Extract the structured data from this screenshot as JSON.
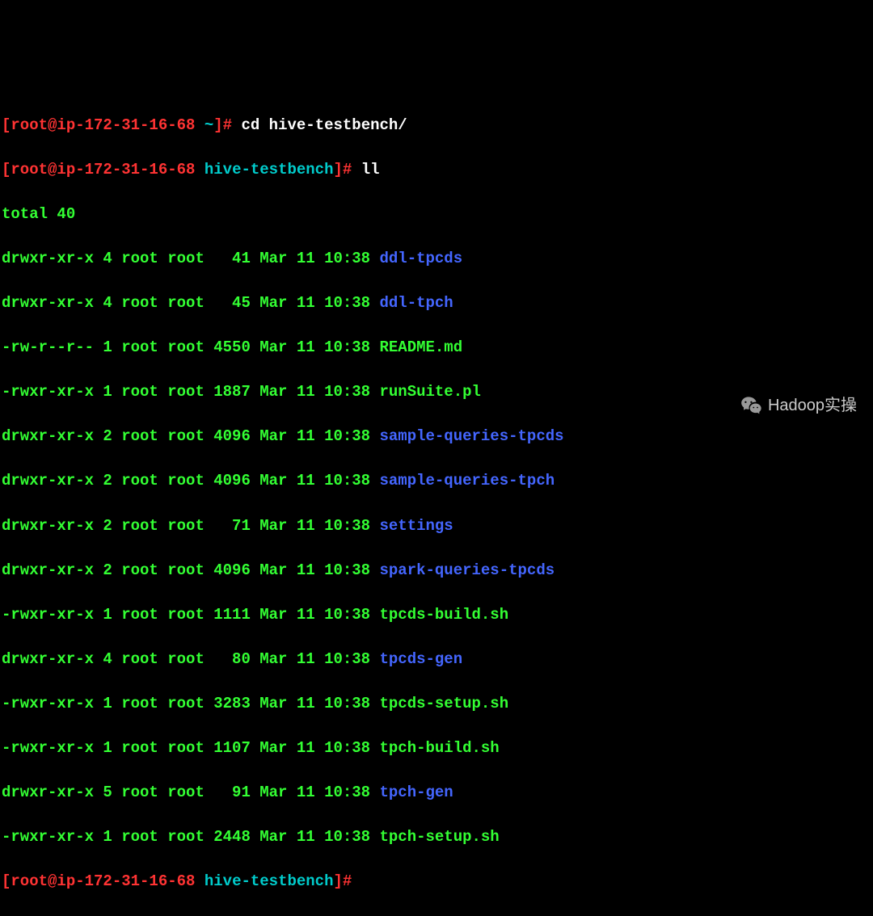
{
  "prompt1": {
    "bracket_open": "[",
    "user_host": "root@ip-172-31-16-68",
    "space": " ",
    "cwd": "~",
    "bracket_close": "]#",
    "command": " cd hive-testbench/"
  },
  "prompt2": {
    "bracket_open": "[",
    "user_host": "root@ip-172-31-16-68",
    "space": " ",
    "cwd": "hive-testbench",
    "bracket_close": "]#",
    "command": " ll"
  },
  "total": "total 40",
  "listing": {
    "l1": {
      "meta": "drwxr-xr-x 4 root root   41 Mar 11 10:38 ",
      "name": "ddl-tpcds"
    },
    "l2": {
      "meta": "drwxr-xr-x 4 root root   45 Mar 11 10:38 ",
      "name": "ddl-tpch"
    },
    "l3": {
      "meta": "-rw-r--r-- 1 root root 4550 Mar 11 10:38 ",
      "name": "README.md"
    },
    "l4": {
      "meta": "-rwxr-xr-x 1 root root 1887 Mar 11 10:38 ",
      "name": "runSuite.pl"
    },
    "l5": {
      "meta": "drwxr-xr-x 2 root root 4096 Mar 11 10:38 ",
      "name": "sample-queries-tpcds"
    },
    "l6": {
      "meta": "drwxr-xr-x 2 root root 4096 Mar 11 10:38 ",
      "name": "sample-queries-tpch"
    },
    "l7": {
      "meta": "drwxr-xr-x 2 root root   71 Mar 11 10:38 ",
      "name": "settings"
    },
    "l8": {
      "meta": "drwxr-xr-x 2 root root 4096 Mar 11 10:38 ",
      "name": "spark-queries-tpcds"
    },
    "l9": {
      "meta": "-rwxr-xr-x 1 root root 1111 Mar 11 10:38 ",
      "name": "tpcds-build.sh"
    },
    "l10": {
      "meta": "drwxr-xr-x 4 root root   80 Mar 11 10:38 ",
      "name": "tpcds-gen"
    },
    "l11": {
      "meta": "-rwxr-xr-x 1 root root 3283 Mar 11 10:38 ",
      "name": "tpcds-setup.sh"
    },
    "l12": {
      "meta": "-rwxr-xr-x 1 root root 1107 Mar 11 10:38 ",
      "name": "tpch-build.sh"
    },
    "l13": {
      "meta": "drwxr-xr-x 5 root root   91 Mar 11 10:38 ",
      "name": "tpch-gen"
    },
    "l14": {
      "meta": "-rwxr-xr-x 1 root root 2448 Mar 11 10:38 ",
      "name": "tpch-setup.sh"
    }
  },
  "prompt3": {
    "bracket_open": "[",
    "user_host": "root@ip-172-31-16-68",
    "space": " ",
    "cwd": "hive-testbench",
    "bracket_close": "]#",
    "command": ""
  },
  "watermark": "Hadoop实操"
}
